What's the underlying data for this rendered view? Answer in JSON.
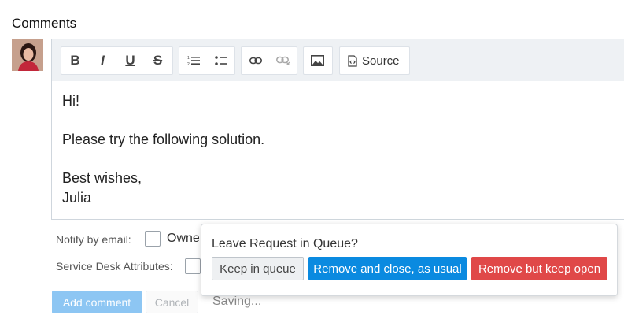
{
  "section_title": "Comments",
  "toolbar": {
    "bold": "B",
    "italic": "I",
    "underline": "U",
    "strike": "S",
    "source_label": "Source"
  },
  "editor_lines": [
    "Hi!",
    "Please try the following solution.",
    "Best wishes,",
    "Julia"
  ],
  "notify_label": "Notify by email:",
  "owner_text": "Owne",
  "service_desk_label": "Service Desk Attributes:",
  "add_comment_label": "Add comment",
  "cancel_label": "Cancel",
  "saving_text": "Saving...",
  "popup": {
    "title": "Leave Request in Queue?",
    "keep_label": "Keep in queue",
    "remove_close_label": "Remove and close, as usual",
    "remove_open_label": "Remove but keep open"
  },
  "colors": {
    "primary": "#0a8ae0",
    "danger": "#e04848",
    "primary_disabled": "#8dc6f3"
  },
  "icons": [
    "bold-icon",
    "italic-icon",
    "underline-icon",
    "strikethrough-icon",
    "numbered-list-icon",
    "bullet-list-icon",
    "link-icon",
    "unlink-icon",
    "image-icon",
    "source-icon"
  ]
}
